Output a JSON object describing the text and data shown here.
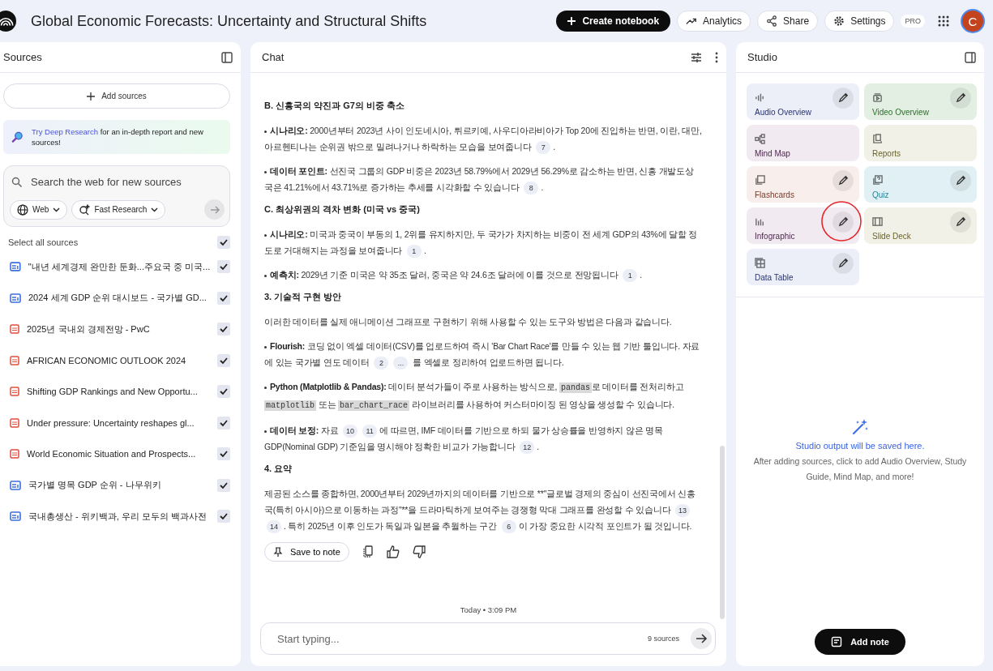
{
  "header": {
    "title": "Global Economic Forecasts: Uncertainty and Structural Shifts",
    "create_button": "Create notebook",
    "analytics_button": "Analytics",
    "share_button": "Share",
    "settings_button": "Settings",
    "plan_badge": "PRO",
    "avatar_letter": "C"
  },
  "sources": {
    "title": "Sources",
    "add_button": "Add sources",
    "promo_link": "Try Deep Research",
    "promo_text": " for an in-depth report and new sources!",
    "search": {
      "placeholder": "Search the web for new sources"
    },
    "web_chip": "Web",
    "research_chip": "Fast Research",
    "select_all": {
      "label": "Select all sources",
      "checked": true
    },
    "items": [
      {
        "kind": "web",
        "title": "\"내년 세계경제 완만한 둔화...주요국 중 미국...",
        "checked": true
      },
      {
        "kind": "web",
        "title": "2024 세계 GDP 순위 대시보드 - 국가별 GD...",
        "checked": true
      },
      {
        "kind": "pdf",
        "title": "2025년 국내외 경제전망 - PwC",
        "checked": true
      },
      {
        "kind": "pdf",
        "title": "AFRICAN ECONOMIC OUTLOOK 2024",
        "checked": true
      },
      {
        "kind": "pdf",
        "title": "Shifting GDP Rankings and New Opportu...",
        "checked": true
      },
      {
        "kind": "pdf",
        "title": "Under pressure: Uncertainty reshapes gl...",
        "checked": true
      },
      {
        "kind": "pdf",
        "title": "World Economic Situation and Prospects...",
        "checked": true
      },
      {
        "kind": "web",
        "title": "국가별 명목 GDP 순위 - 나무위키",
        "checked": true
      },
      {
        "kind": "web",
        "title": "국내총생산 - 위키백과, 우리 모두의 백과사전",
        "checked": true
      }
    ]
  },
  "chat": {
    "title": "Chat",
    "blocks": [
      {
        "kind": "heading",
        "text": "B. 신흥국의 약진과 G7의 비중 축소"
      },
      {
        "kind": "bullet",
        "label": "시나리오:",
        "parts": [
          {
            "kind": "text",
            "v": " 2000년부터 2023년 사이 인도네시아, 튀르키예, 사우디아라비아가 Top 20에 진입하는 반면, 이란, 대만, 아르헨티나는 순위권 밖으로 밀려나거나 하락하는 모습을 보여줍니다 "
          },
          {
            "kind": "cite",
            "v": "7"
          },
          {
            "kind": "text",
            "v": "."
          }
        ]
      },
      {
        "kind": "bullet",
        "label": "데이터 포인트:",
        "parts": [
          {
            "kind": "text",
            "v": " 선진국 그룹의 GDP 비중은 2023년 58.79%에서 2029년 56.29%로 감소하는 반면, 신흥 개발도상국은 41.21%에서 43.71%로 증가하는 추세를 시각화할 수 있습니다 "
          },
          {
            "kind": "cite",
            "v": "8"
          },
          {
            "kind": "text",
            "v": "."
          }
        ]
      },
      {
        "kind": "heading",
        "text": "C. 최상위권의 격차 변화 (미국 vs 중국)"
      },
      {
        "kind": "bullet",
        "label": "시나리오:",
        "parts": [
          {
            "kind": "text",
            "v": " 미국과 중국이 부동의 1, 2위를 유지하지만, 두 국가가 차지하는 비중이 전 세계 GDP의 43%에 달할 정도로 거대해지는 과정을 보여줍니다 "
          },
          {
            "kind": "cite",
            "v": "1"
          },
          {
            "kind": "text",
            "v": "."
          }
        ]
      },
      {
        "kind": "bullet",
        "label": "예측치:",
        "parts": [
          {
            "kind": "text",
            "v": " 2029년 기준 미국은 약 35조 달러, 중국은 약 24.6조 달러에 이를 것으로 전망됩니다 "
          },
          {
            "kind": "cite",
            "v": "1"
          },
          {
            "kind": "text",
            "v": "."
          }
        ]
      },
      {
        "kind": "heading",
        "text": "3. 기술적 구현 방안"
      },
      {
        "kind": "para",
        "parts": [
          {
            "kind": "text",
            "v": "이러한 데이터를 실제 애니메이션 그래프로 구현하기 위해 사용할 수 있는 도구와 방법은 다음과 같습니다."
          }
        ]
      },
      {
        "kind": "bullet",
        "label": "Flourish:",
        "parts": [
          {
            "kind": "text",
            "v": " 코딩 없이 엑셀 데이터(CSV)를 업로드하여 즉시 'Bar Chart Race'를 만들 수 있는 웹 기반 툴입니다. 자료에 있는 국가별 연도 데이터 "
          },
          {
            "kind": "cite",
            "v": "2"
          },
          {
            "kind": "cite",
            "v": "..."
          },
          {
            "kind": "text",
            "v": " 를 엑셀로 정리하여 업로드하면 됩니다."
          }
        ]
      },
      {
        "kind": "bullet",
        "label": "Python (Matplotlib & Pandas):",
        "parts": [
          {
            "kind": "text",
            "v": " 데이터 분석가들이 주로 사용하는 방식으로, "
          },
          {
            "kind": "code",
            "v": "pandas"
          },
          {
            "kind": "text",
            "v": "로 데이터를 전처리하고 "
          },
          {
            "kind": "code",
            "v": "matplotlib"
          },
          {
            "kind": "text",
            "v": " 또는 "
          },
          {
            "kind": "code",
            "v": "bar_chart_race"
          },
          {
            "kind": "text",
            "v": " 라이브러리를 사용하여 커스터마이징 된 영상을 생성할 수 있습니다."
          }
        ]
      },
      {
        "kind": "bullet",
        "label": "데이터 보정:",
        "parts": [
          {
            "kind": "text",
            "v": " 자료 "
          },
          {
            "kind": "cite",
            "v": "10"
          },
          {
            "kind": "cite",
            "v": "11"
          },
          {
            "kind": "text",
            "v": "에 따르면, IMF 데이터를 기반으로 하되 물가 상승률을 반영하지 않은 명목 GDP(Nominal GDP) 기준임을 명시해야 정확한 비교가 가능합니다 "
          },
          {
            "kind": "cite",
            "v": "12"
          },
          {
            "kind": "text",
            "v": "."
          }
        ]
      },
      {
        "kind": "heading",
        "text": "4. 요약"
      },
      {
        "kind": "para",
        "parts": [
          {
            "kind": "text",
            "v": "제공된 소스를 종합하면, 2000년부터 2029년까지의 데이터를 기반으로 **\"글로벌 경제의 중심이 선진국에서 신흥국(특히 아시아)으로 이동하는 과정\"**을 드라마틱하게 보여주는 경쟁형 막대 그래프를 완성할 수 있습니다 "
          },
          {
            "kind": "cite",
            "v": "13"
          },
          {
            "kind": "cite",
            "v": "14"
          },
          {
            "kind": "text",
            "v": ". 특히 2025년 이후 인도가 독일과 일본을 추월하는 구간 "
          },
          {
            "kind": "cite",
            "v": "6"
          },
          {
            "kind": "text",
            "v": "이 가장 중요한 시각적 포인트가 될 것입니다."
          }
        ]
      }
    ],
    "save_button": "Save to note",
    "timestamp": "Today • 3:09 PM",
    "input": {
      "placeholder": "Start typing..."
    },
    "source_count": "9 sources"
  },
  "studio": {
    "title": "Studio",
    "tiles": [
      {
        "kind": "audio",
        "label": "Audio Overview",
        "color": "#eceef8",
        "editable": true,
        "highlighted": false
      },
      {
        "kind": "video",
        "label": "Video Overview",
        "color": "#e3efe3",
        "editable": true,
        "highlighted": false
      },
      {
        "kind": "mindmap",
        "label": "Mind Map",
        "color": "#f1ebf1",
        "editable": false,
        "highlighted": false
      },
      {
        "kind": "reports",
        "label": "Reports",
        "color": "#f2f1e7",
        "editable": false,
        "highlighted": false
      },
      {
        "kind": "flashcards",
        "label": "Flashcards",
        "color": "#f8eeeb",
        "editable": true,
        "highlighted": false
      },
      {
        "kind": "quiz",
        "label": "Quiz",
        "color": "#e1f0f5",
        "editable": true,
        "highlighted": false
      },
      {
        "kind": "infographic",
        "label": "Infographic",
        "color": "#f1ebf1",
        "editable": true,
        "highlighted": true
      },
      {
        "kind": "slides",
        "label": "Slide Deck",
        "color": "#f2f1e7",
        "editable": true,
        "highlighted": false
      },
      {
        "kind": "table",
        "label": "Data Table",
        "color": "#eceef8",
        "editable": true,
        "highlighted": false
      }
    ],
    "empty_title": "Studio output will be saved here.",
    "empty_text": "After adding sources, click to add Audio Overview, Study Guide, Mind Map, and more!",
    "add_note_button": "Add note"
  }
}
